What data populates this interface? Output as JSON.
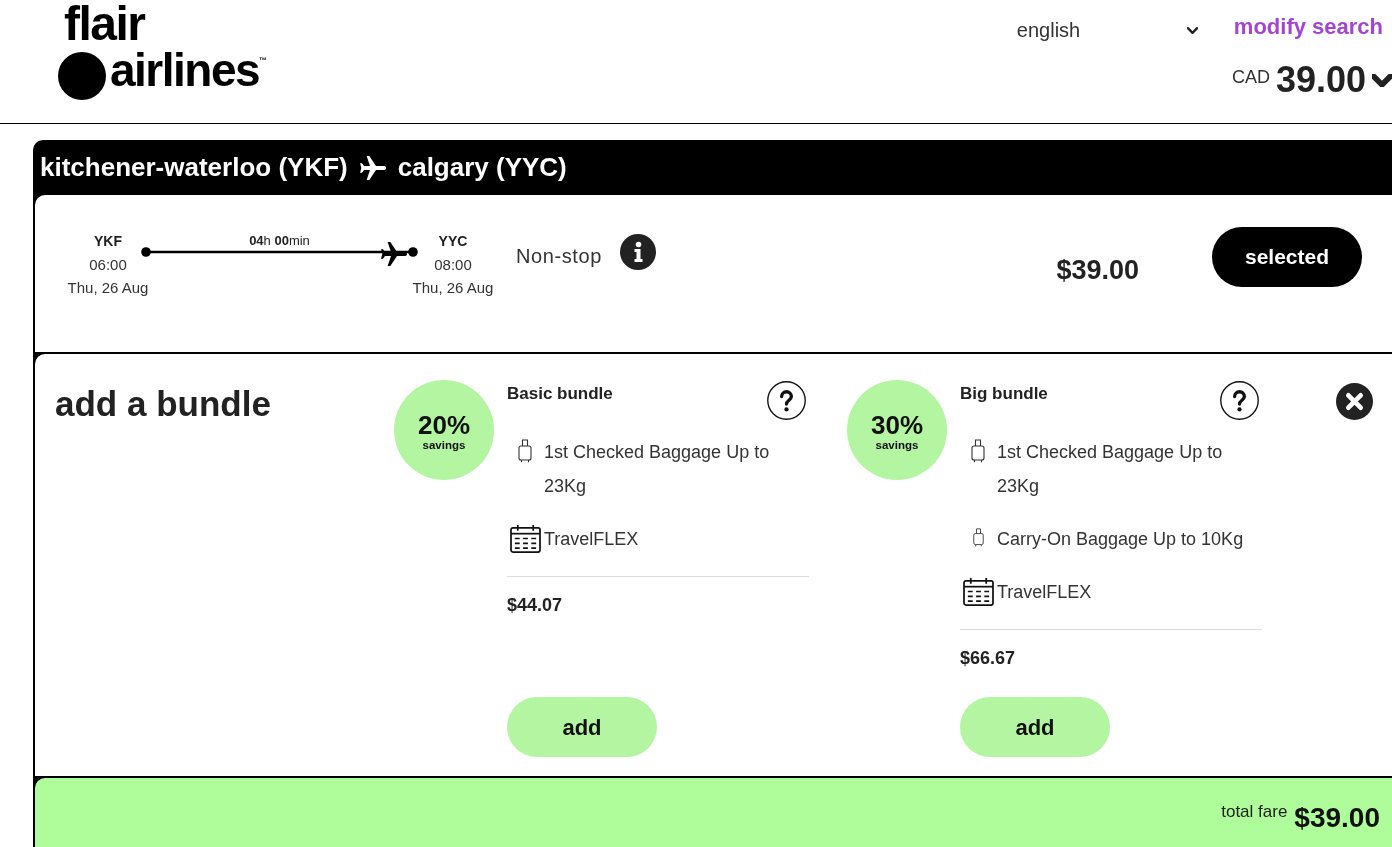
{
  "header": {
    "logo": {
      "top": "flair",
      "bottom": "airlines",
      "trademark": "™"
    },
    "language": "english",
    "modify_search": "modify search",
    "total": {
      "currency": "CAD",
      "amount": "39.00"
    }
  },
  "route": {
    "origin": "kitchener-waterloo (YKF)",
    "destination": "calgary (YYC)"
  },
  "flight": {
    "departure": {
      "code": "YKF",
      "time": "06:00",
      "date": "Thu, 26 Aug"
    },
    "duration": "**04**h **00**min",
    "arrival": {
      "code": "YYC",
      "time": "08:00",
      "date": "Thu, 26 Aug"
    },
    "stops": "Non-stop",
    "price": "$39.00",
    "select_button": {
      "label": "selected",
      "selected": true
    }
  },
  "bundle_section": {
    "title": "add a bundle",
    "bundles": [
      {
        "savings": "20%",
        "savings_label": "savings",
        "name": "Basic bundle",
        "features": [
          {
            "kind": "checked-bag",
            "text": "1st Checked Baggage Up to 23Kg"
          },
          {
            "kind": "flex",
            "text": "TravelFLEX"
          }
        ],
        "price": "$44.07",
        "button": "add"
      },
      {
        "savings": "30%",
        "savings_label": "savings",
        "name": "Big bundle",
        "features": [
          {
            "kind": "checked-bag",
            "text": "1st Checked Baggage Up to 23Kg"
          },
          {
            "kind": "carry-on",
            "text": "Carry-On Baggage Up to 10Kg"
          },
          {
            "kind": "flex",
            "text": "TravelFLEX"
          }
        ],
        "price": "$66.67",
        "button": "add"
      }
    ]
  },
  "footer": {
    "label": "total fare",
    "amount": "$39.00"
  }
}
